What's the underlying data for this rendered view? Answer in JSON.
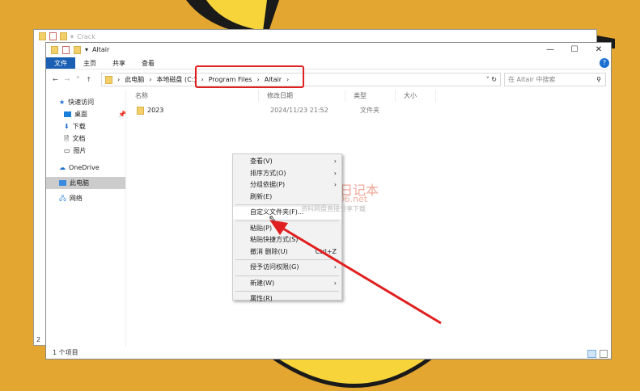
{
  "back_window": {
    "title": "Crack",
    "status_fragment": "2"
  },
  "window": {
    "title": "Altair",
    "controls": {
      "minimize": "—",
      "maximize": "☐",
      "close": "✕"
    },
    "help": "?"
  },
  "ribbon": {
    "tabs": [
      "文件",
      "主页",
      "共享",
      "查看"
    ]
  },
  "address": {
    "crumbs": [
      "此电脑",
      "本地磁盘 (C:)",
      "Program Files",
      "Altair"
    ],
    "search_placeholder": "在 Altair 中搜索"
  },
  "sidebar": {
    "items": [
      {
        "label": "快速访问",
        "icon": "star-icon"
      },
      {
        "label": "桌面",
        "icon": "desktop-icon",
        "pinned": true
      },
      {
        "label": "下载",
        "icon": "download-icon",
        "pinned": true
      },
      {
        "label": "文档",
        "icon": "document-icon",
        "pinned": true
      },
      {
        "label": "图片",
        "icon": "picture-icon",
        "pinned": true
      },
      {
        "label": "OneDrive",
        "icon": "cloud-icon"
      },
      {
        "label": "此电脑",
        "icon": "computer-icon",
        "selected": true
      },
      {
        "label": "网络",
        "icon": "network-icon"
      }
    ]
  },
  "columns": [
    "名称",
    "修改日期",
    "类型",
    "大小"
  ],
  "files": [
    {
      "name": "2023",
      "modified": "2024/11/23 21:52",
      "type": "文件夹",
      "size": ""
    }
  ],
  "status": "1 个项目",
  "context_menu": {
    "items": [
      "查看(V)",
      "排序方式(O)",
      "分组依据(P)",
      "刷新(E)",
      "自定义文件夹(F)...",
      "粘贴(P)",
      "粘贴快捷方式(S)",
      "撤消 删除(U)",
      "授予访问权限(G)",
      "新建(W)",
      "属性(R)"
    ],
    "shortcut": "Ctrl+Z"
  },
  "watermark": {
    "title": "丁同学日记本",
    "url": "www.ts006.net",
    "tagline": "资料网盘直接分享下载"
  },
  "colors": {
    "background": "#E3A630",
    "accent": "#1a5fb4",
    "highlight": "#e02020"
  }
}
